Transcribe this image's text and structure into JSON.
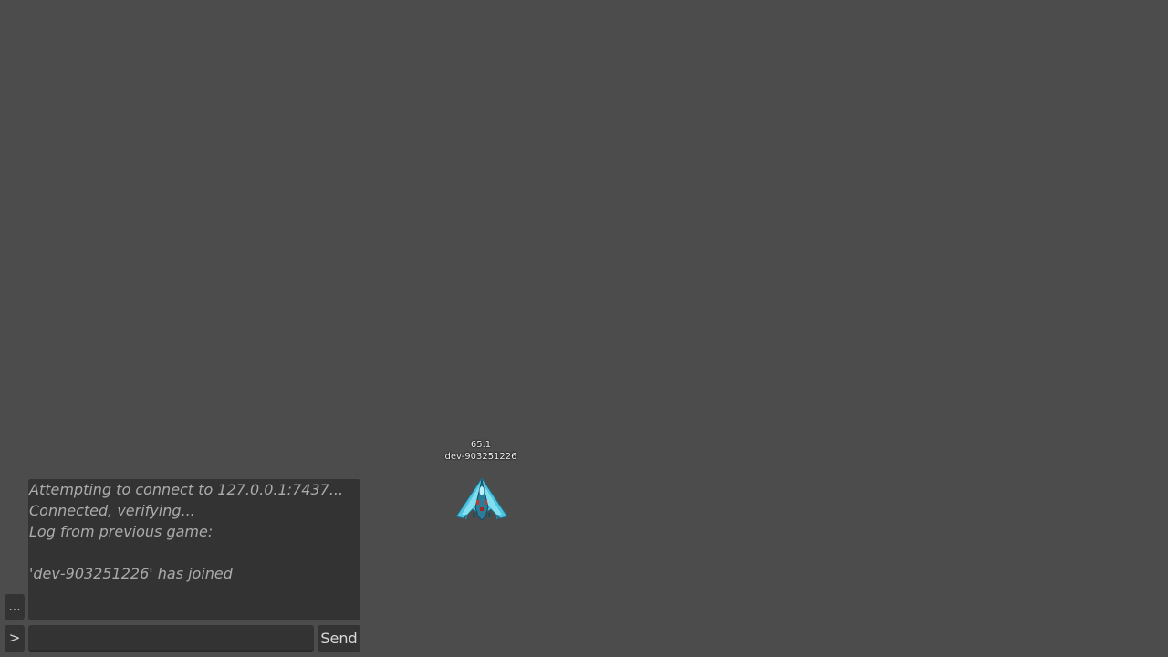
{
  "player": {
    "hp": "65.1",
    "name": "dev-903251226"
  },
  "chat": {
    "log": [
      "Attempting to connect to 127.0.0.1:7437...",
      "Connected, verifying...",
      "Log from previous game:",
      "",
      "'dev-903251226' has joined"
    ],
    "menu_label": "...",
    "prompt_label": ">",
    "input_value": "",
    "input_placeholder": "",
    "send_label": "Send"
  },
  "colors": {
    "background": "#4c4c4c",
    "panel": "#333333",
    "log_text": "#ababab",
    "ship_primary": "#5fd3e8",
    "ship_accent": "#c0392b"
  },
  "icons": {
    "ship": "player-ship-icon"
  }
}
